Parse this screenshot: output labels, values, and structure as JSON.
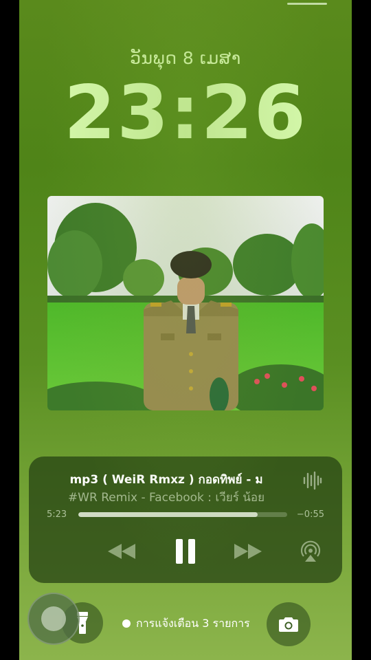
{
  "lockscreen": {
    "date": "ວັນພຸດ 8 ເມສາ",
    "time": "23:26"
  },
  "now_playing": {
    "title": "mp3      ( WeiR Rmxz ) กอดทิพย์ - ม",
    "artist": "#WR Remix - Facebook : เวียร์ น้อย",
    "elapsed": "5:23",
    "remaining": "−0:55",
    "progress_fraction": 0.86,
    "icons": {
      "rewind": "rewind-icon",
      "pause": "pause-icon",
      "forward": "fast-forward-icon",
      "airplay": "airplay-icon",
      "waveform": "waveform-icon"
    }
  },
  "bottom_bar": {
    "notification_text": "การแจ้งเตือน 3 รายการ",
    "flashlight_icon": "flashlight-icon",
    "camera_icon": "camera-icon"
  },
  "colors": {
    "clock": "#d6f9ad",
    "background": "#4f8418"
  }
}
